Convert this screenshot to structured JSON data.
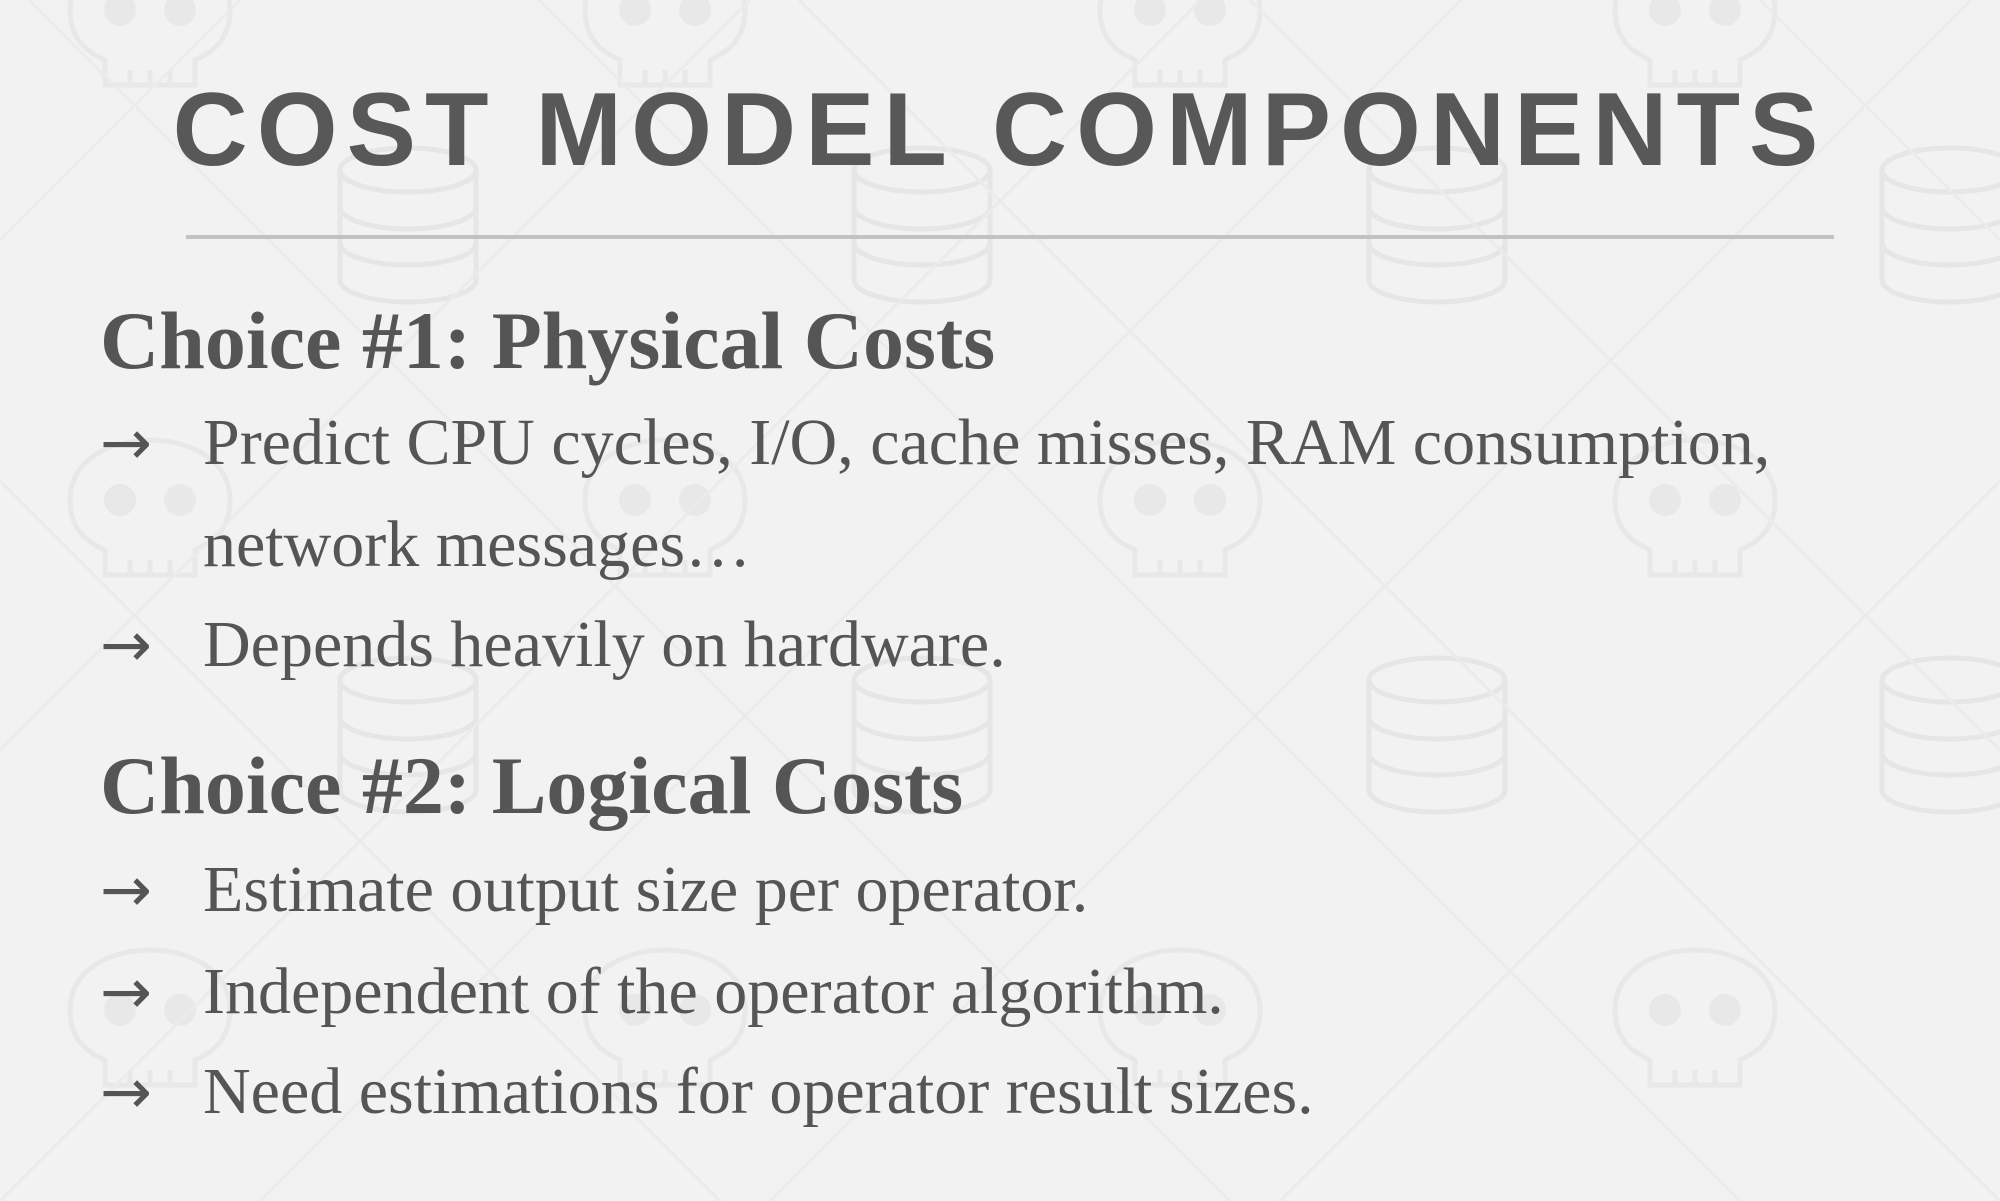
{
  "slide": {
    "title": "COST MODEL COMPONENTS",
    "sections": [
      {
        "heading": "Choice #1: Physical Costs",
        "bullets": [
          {
            "arrow": "→",
            "text": "Predict CPU cycles, I/O, cache misses, RAM consumption,",
            "continuation": "network messages…"
          },
          {
            "arrow": "→",
            "text": "Depends heavily on hardware."
          }
        ]
      },
      {
        "heading": "Choice #2: Logical Costs",
        "bullets": [
          {
            "arrow": "→",
            "text": "Estimate output size per operator."
          },
          {
            "arrow": "→",
            "text": "Independent of the operator algorithm."
          },
          {
            "arrow": "→",
            "text": "Need estimations for operator result sizes."
          }
        ]
      }
    ]
  },
  "colors": {
    "background": "#f2f2f2",
    "text": "#555555",
    "title": "#585858",
    "rule": "#c2c2c2",
    "watermark": "#e6e6e6"
  },
  "watermark_icons": [
    "database-icon",
    "skull-icon"
  ]
}
